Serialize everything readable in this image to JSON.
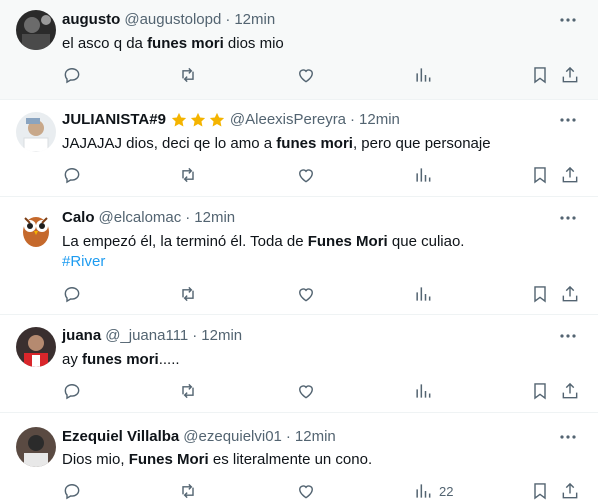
{
  "colors": {
    "accent": "#1d9bf0",
    "text": "#0f1419",
    "muted": "#536471",
    "star": "#f4b400",
    "highlight_bg": "#f7f9f9"
  },
  "tweets": [
    {
      "name": "augusto",
      "handle": "@augustolopd",
      "sep": "·",
      "time": "12min",
      "text_parts": [
        "el asco q da ",
        "funes mori",
        " dios mio"
      ],
      "avatar": "avatar-photo"
    },
    {
      "name": "JULIANISTA#9",
      "stars_icon": "star-icon",
      "handle": "@AleexisPereyra",
      "sep": "·",
      "time": "12min",
      "text_parts": [
        "JAJAJAJ dios, deci qe lo amo a ",
        "funes mori",
        ", pero que personaje"
      ],
      "avatar": "avatar-photo"
    },
    {
      "name": "Calo",
      "handle": "@elcalomac",
      "sep": "·",
      "time": "12min",
      "text_parts": [
        "La empezó él, la terminó él. Toda de ",
        "Funes Mori",
        " que culiao."
      ],
      "hashtag": "#River",
      "avatar": "owl-avatar"
    },
    {
      "name": "juana",
      "handle": "@_juana111",
      "sep": "·",
      "time": "12min",
      "text_parts": [
        "ay ",
        "funes mori",
        "....."
      ],
      "avatar": "avatar-photo"
    },
    {
      "name": "Ezequiel Villalba",
      "handle": "@ezequielvi01",
      "sep": "·",
      "time": "12min",
      "text_parts": [
        "Dios mio, ",
        "Funes Mori",
        " es literalmente un cono."
      ],
      "views": "22",
      "avatar": "avatar-photo"
    }
  ]
}
